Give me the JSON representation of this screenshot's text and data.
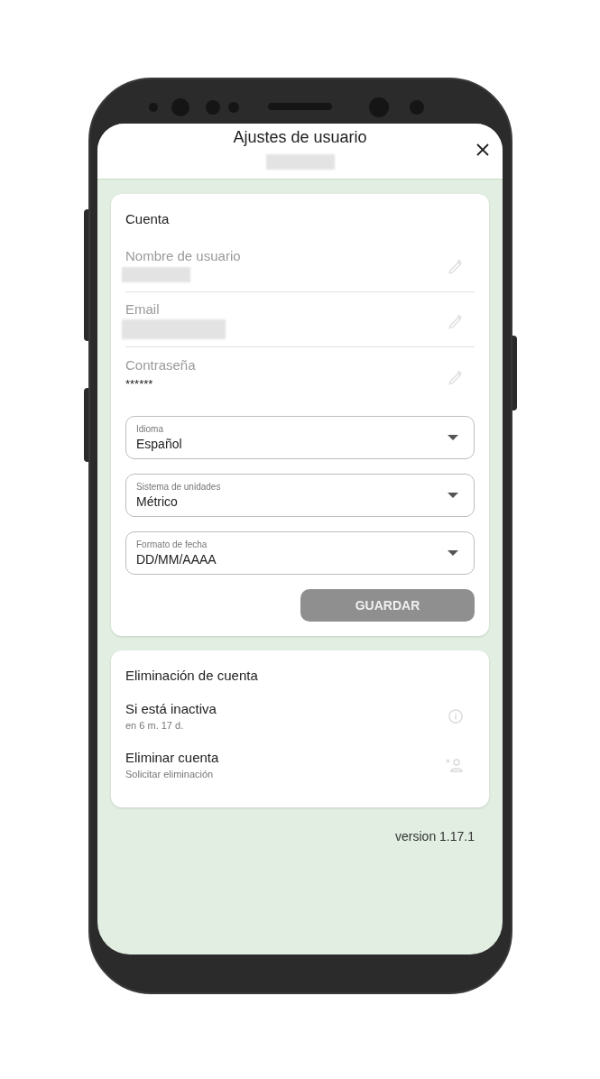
{
  "header": {
    "title": "Ajustes de usuario",
    "subtitle_redacted": true
  },
  "account": {
    "title": "Cuenta",
    "fields": [
      {
        "label": "Nombre de usuario",
        "redacted": true
      },
      {
        "label": "Email",
        "redacted": true
      },
      {
        "label": "Contraseña",
        "value": "******",
        "redacted": false
      }
    ],
    "selects": [
      {
        "label": "Idioma",
        "value": "Español"
      },
      {
        "label": "Sistema de unidades",
        "value": "Métrico"
      },
      {
        "label": "Formato de fecha",
        "value": "DD/MM/AAAA"
      }
    ],
    "save_button": {
      "label": "GUARDAR",
      "disabled": true
    }
  },
  "deletion": {
    "title": "Eliminación de cuenta",
    "items": [
      {
        "kind": "info",
        "title": "Si está inactiva",
        "subtitle": "en 6 m. 17 d."
      },
      {
        "kind": "remove-user",
        "title": "Eliminar cuenta",
        "subtitle": "Solicitar eliminación"
      }
    ]
  },
  "version": "version 1.17.1"
}
